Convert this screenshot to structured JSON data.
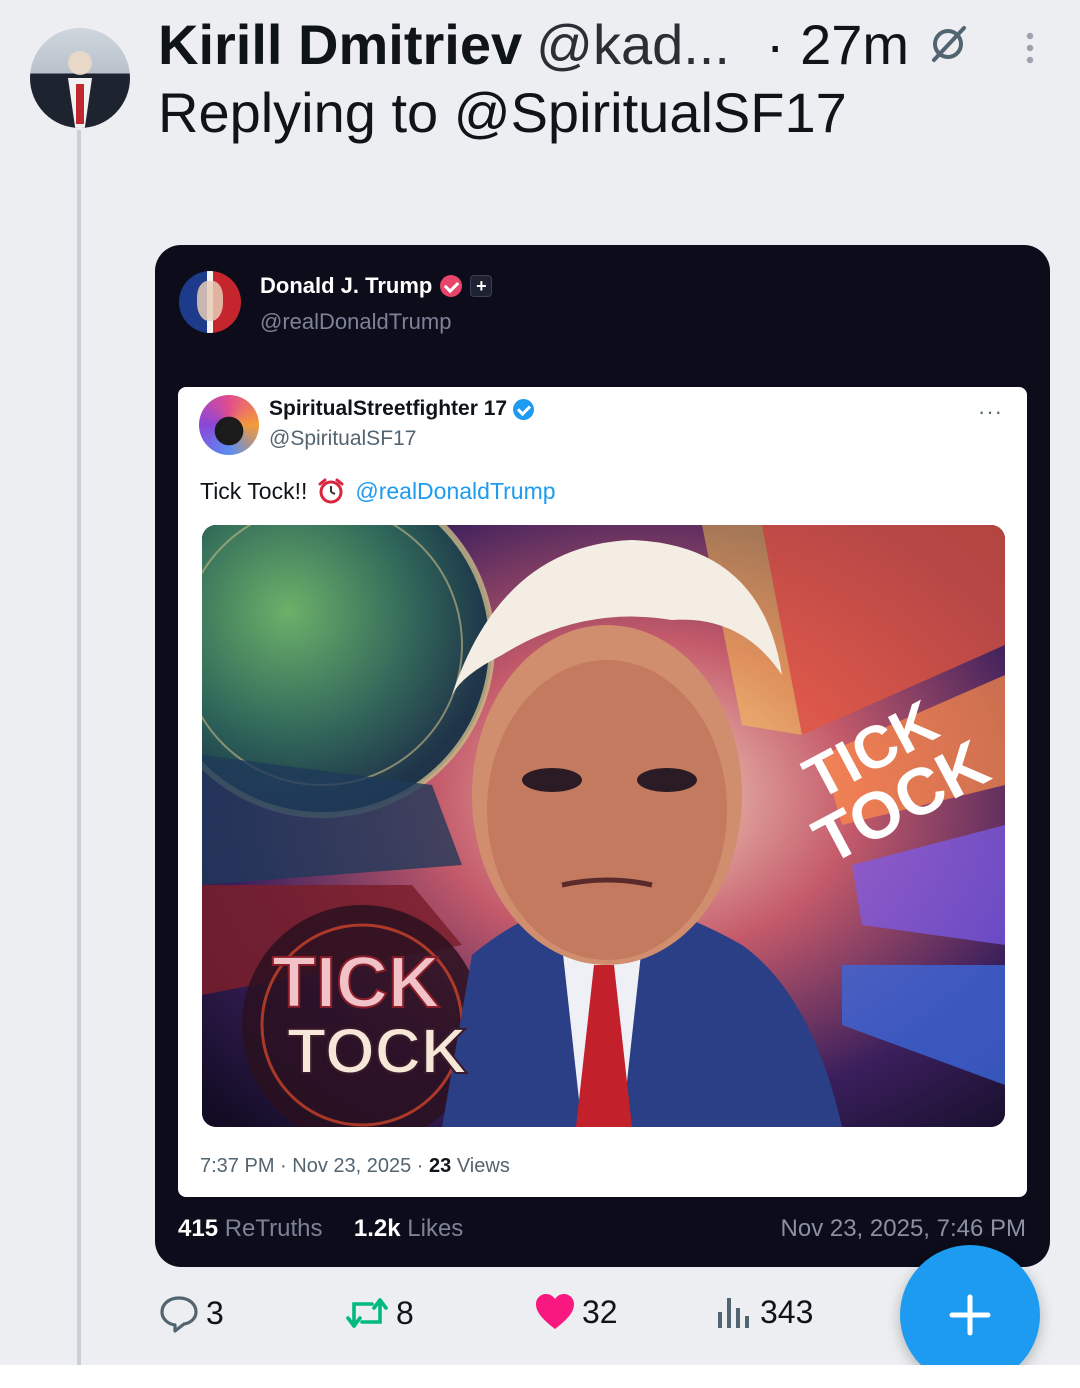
{
  "reply_post": {
    "author_name": "Kirill Dmitriev",
    "author_handle": "@kad...",
    "time": "· 27m",
    "replying_prefix": "Replying to",
    "replying_to": "@SpiritualSF17"
  },
  "truth": {
    "name": "Donald J. Trump",
    "handle": "@realDonaldTrump",
    "plus_badge": "+",
    "retruths_count": "415",
    "retruths_label": "ReTruths",
    "likes_count": "1.2k",
    "likes_label": "Likes",
    "date": "Nov 23, 2025, 7:46 PM"
  },
  "embedded_post": {
    "name": "SpiritualStreetfighter 17",
    "handle": "@SpiritualSF17",
    "more": "···",
    "text": "Tick Tock!!",
    "mention": "@realDonaldTrump",
    "image_text_1": "TICK",
    "image_text_2": "TOCK",
    "image_text_3": "TICK",
    "image_text_4": "TOCK",
    "meta_time": "7:37 PM · Nov 23, 2025 ·",
    "views_count": "23",
    "views_label": "Views"
  },
  "actions": {
    "replies": "3",
    "reposts": "8",
    "likes": "32",
    "views": "343"
  },
  "colors": {
    "accent": "#1d9bf0",
    "like": "#f91880",
    "repost": "#00ba7c",
    "truth_bg": "#0c0c1a"
  },
  "icons": {
    "reply_off": "reply-restricted-icon",
    "more": "more-vertical-icon",
    "fab": "plus-icon"
  }
}
